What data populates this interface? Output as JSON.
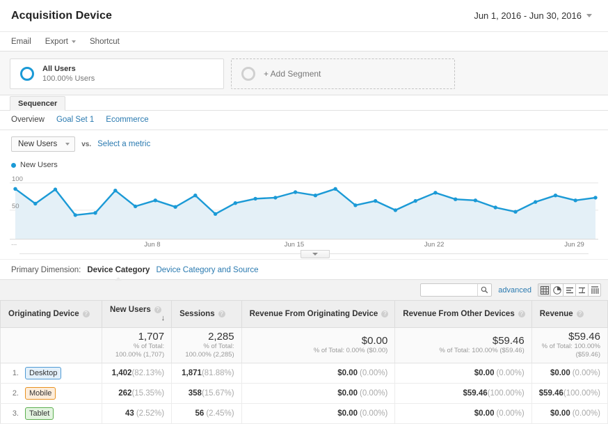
{
  "header": {
    "title": "Acquisition Device",
    "date_range": "Jun 1, 2016 - Jun 30, 2016"
  },
  "actions": [
    {
      "label": "Email",
      "name": "email-action",
      "caret": false
    },
    {
      "label": "Export",
      "name": "export-action",
      "caret": true
    },
    {
      "label": "Shortcut",
      "name": "shortcut-action",
      "caret": false
    }
  ],
  "segments": {
    "all_users": {
      "name": "All Users",
      "sub": "100.00% Users"
    },
    "add_segment": "+ Add Segment"
  },
  "report_tab": "Sequencer",
  "subtabs": [
    {
      "label": "Overview",
      "active": true
    },
    {
      "label": "Goal Set 1",
      "active": false
    },
    {
      "label": "Ecommerce",
      "active": false
    }
  ],
  "metric_bar": {
    "selected_metric": "New Users",
    "vs": "vs.",
    "select_metric": "Select a metric"
  },
  "chart_data": {
    "type": "line",
    "title": "",
    "legend": [
      "New Users"
    ],
    "legend_position": "top-left",
    "series_color": "#1b9ad6",
    "fill_color": "#e4f0f7",
    "xlabel": "",
    "ylabel": "",
    "ylim": [
      0,
      115
    ],
    "yticks": [
      50,
      100
    ],
    "ytick_labels": [
      "50",
      "100"
    ],
    "grid": true,
    "x_axis_prefix": "...",
    "xtick_labels": [
      "Jun 8",
      "Jun 15",
      "Jun 22",
      "Jun 29"
    ],
    "xtick_indices": [
      7,
      14,
      21,
      28
    ],
    "x": [
      "Jun 1",
      "Jun 2",
      "Jun 3",
      "Jun 4",
      "Jun 5",
      "Jun 6",
      "Jun 7",
      "Jun 8",
      "Jun 9",
      "Jun 10",
      "Jun 11",
      "Jun 12",
      "Jun 13",
      "Jun 14",
      "Jun 15",
      "Jun 16",
      "Jun 17",
      "Jun 18",
      "Jun 19",
      "Jun 20",
      "Jun 21",
      "Jun 22",
      "Jun 23",
      "Jun 24",
      "Jun 25",
      "Jun 26",
      "Jun 27",
      "Jun 28",
      "Jun 29",
      "Jun 30"
    ],
    "values": [
      89,
      62,
      88,
      41,
      45,
      86,
      57,
      68,
      56,
      77,
      43,
      63,
      71,
      73,
      83,
      77,
      89,
      59,
      67,
      50,
      67,
      82,
      70,
      68,
      55,
      47,
      65,
      77,
      68,
      73
    ]
  },
  "primary_dimension": {
    "label": "Primary Dimension:",
    "active": "Device Category",
    "link": "Device Category and Source"
  },
  "table_toolbar": {
    "search_value": "",
    "search_placeholder": "",
    "search_icon": "search-icon",
    "advanced": "advanced",
    "view_icons": [
      {
        "name": "table-view-icon",
        "glyph": "table",
        "active": true
      },
      {
        "name": "pie-view-icon",
        "glyph": "pie",
        "active": false
      },
      {
        "name": "performance-view-icon",
        "glyph": "bars",
        "active": false
      },
      {
        "name": "comparison-view-icon",
        "glyph": "compare",
        "active": false
      },
      {
        "name": "pivot-view-icon",
        "glyph": "pivot",
        "active": false
      }
    ]
  },
  "table": {
    "columns": [
      {
        "label": "Originating Device",
        "help": true,
        "sorted": false
      },
      {
        "label": "New Users",
        "help": true,
        "sorted": true,
        "sort_arrow": "↓"
      },
      {
        "label": "Sessions",
        "help": true,
        "sorted": false
      },
      {
        "label": "Revenue From Originating Device",
        "help": true,
        "sorted": false
      },
      {
        "label": "Revenue From Other Devices",
        "help": true,
        "sorted": false
      },
      {
        "label": "Revenue",
        "help": true,
        "sorted": false
      }
    ],
    "summary": [
      {
        "value": "1,707",
        "sub": "% of Total: 100.00% (1,707)"
      },
      {
        "value": "2,285",
        "sub": "% of Total: 100.00% (2,285)"
      },
      {
        "value": "$0.00",
        "sub": "% of Total: 0.00% ($0.00)"
      },
      {
        "value": "$59.46",
        "sub": "% of Total: 100.00% ($59.46)"
      },
      {
        "value": "$59.46",
        "sub": "% of Total: 100.00% ($59.46)"
      }
    ],
    "rows": [
      {
        "num": "1.",
        "device": "Desktop",
        "device_class": "desktop",
        "new_users": "1,402",
        "new_users_pct": "(82.13%)",
        "sessions": "1,871",
        "sessions_pct": "(81.88%)",
        "rev_orig": "$0.00",
        "rev_orig_pct": "(0.00%)",
        "rev_other": "$0.00",
        "rev_other_pct": "(0.00%)",
        "revenue": "$0.00",
        "revenue_pct": "(0.00%)"
      },
      {
        "num": "2.",
        "device": "Mobile",
        "device_class": "mobile",
        "new_users": "262",
        "new_users_pct": "(15.35%)",
        "sessions": "358",
        "sessions_pct": "(15.67%)",
        "rev_orig": "$0.00",
        "rev_orig_pct": "(0.00%)",
        "rev_other": "$59.46",
        "rev_other_pct": "(100.00%)",
        "revenue": "$59.46",
        "revenue_pct": "(100.00%)"
      },
      {
        "num": "3.",
        "device": "Tablet",
        "device_class": "tablet",
        "new_users": "43",
        "new_users_pct": "(2.52%)",
        "sessions": "56",
        "sessions_pct": "(2.45%)",
        "rev_orig": "$0.00",
        "rev_orig_pct": "(0.00%)",
        "rev_other": "$0.00",
        "rev_other_pct": "(0.00%)",
        "revenue": "$0.00",
        "revenue_pct": "(0.00%)"
      }
    ]
  }
}
